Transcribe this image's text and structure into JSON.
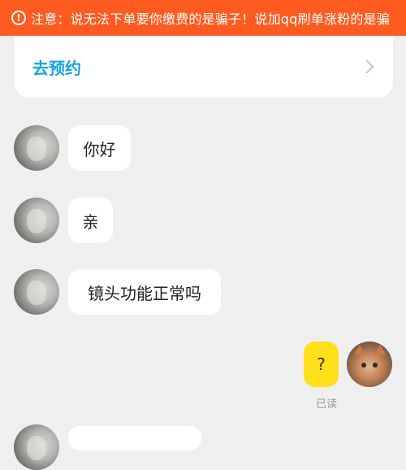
{
  "notice": {
    "icon": "exclamation-circle-icon",
    "text": "注意：说无法下单要你缴费的是骗子！说加qq刷单涨粉的是骗"
  },
  "booking": {
    "label": "去预约",
    "icon": "chevron-right-icon"
  },
  "messages": [
    {
      "from": "agent",
      "text": "你好"
    },
    {
      "from": "agent",
      "text": "亲"
    },
    {
      "from": "agent",
      "text": "镜头功能正常吗"
    },
    {
      "from": "me",
      "text": "?",
      "status": "已读"
    }
  ],
  "colors": {
    "notice_bg": "#ff5a1f",
    "accent": "#17a3df",
    "my_bubble": "#ffe01a",
    "background": "#efefef"
  }
}
